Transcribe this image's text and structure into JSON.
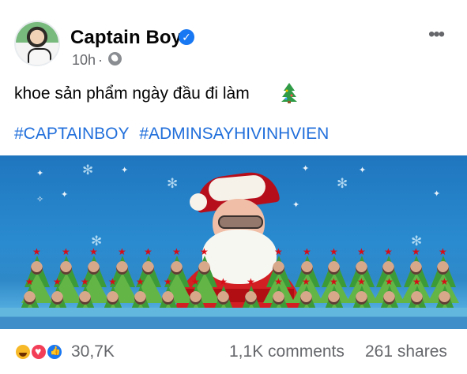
{
  "post": {
    "author": "Captain Boy",
    "time": "10h",
    "separator": "·",
    "text": "khoe sản phẩm ngày đầu đi làm",
    "hashtags": [
      "#CAPTAINBOY",
      "#ADMINSAYHIVINHVIEN"
    ],
    "more_label": "•••"
  },
  "icons": {
    "verified": "verified-badge-icon",
    "audience": "globe-icon",
    "emoji": "christmas-tree-emoji",
    "reactions": [
      "haha-icon",
      "love-icon",
      "like-icon"
    ]
  },
  "colors": {
    "brand_blue": "#1877f2",
    "hashtag": "#216fdb",
    "image_sky": "#2a8bd0",
    "tree_green": "#63b646"
  },
  "stats": {
    "reactions": "30,7K",
    "comments": "1,1K comments",
    "shares": "261 shares"
  }
}
